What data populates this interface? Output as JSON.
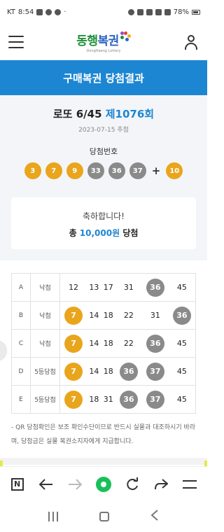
{
  "status_bar": {
    "carrier": "KT",
    "time": "8:54",
    "battery": "78%"
  },
  "app": {
    "logo_main": "동행",
    "logo_accent": "복권",
    "logo_sub": "DongHaeng Lottery"
  },
  "banner": {
    "title": "구매복권 당첨결과"
  },
  "draw": {
    "game": "로또 6/45",
    "round": "제1076회",
    "date": "2023-07-15 추첨",
    "numbers_label": "당첨번호",
    "numbers": [
      "3",
      "7",
      "9",
      "33",
      "36",
      "37"
    ],
    "plus": "+",
    "bonus": "10"
  },
  "prize": {
    "message": "축하합니다!",
    "prefix": "총",
    "amount": "10,000원",
    "suffix": "당첨"
  },
  "games": [
    {
      "label": "A",
      "result": "낙첨",
      "numbers": [
        "12",
        "13",
        "17",
        "31",
        "36",
        "45"
      ],
      "matched": [
        false,
        false,
        false,
        false,
        true,
        false
      ]
    },
    {
      "label": "B",
      "result": "낙첨",
      "numbers": [
        "7",
        "14",
        "18",
        "22",
        "31",
        "36"
      ],
      "matched": [
        true,
        false,
        false,
        false,
        false,
        true
      ]
    },
    {
      "label": "C",
      "result": "낙첨",
      "numbers": [
        "7",
        "14",
        "18",
        "22",
        "36",
        "45"
      ],
      "matched": [
        true,
        false,
        false,
        false,
        true,
        false
      ]
    },
    {
      "label": "D",
      "result": "5등당첨",
      "numbers": [
        "7",
        "14",
        "18",
        "36",
        "37",
        "45"
      ],
      "matched": [
        true,
        false,
        false,
        true,
        true,
        false
      ]
    },
    {
      "label": "E",
      "result": "5등당첨",
      "numbers": [
        "7",
        "18",
        "31",
        "36",
        "37",
        "45"
      ],
      "matched": [
        true,
        false,
        false,
        true,
        true,
        false
      ]
    }
  ],
  "notice": "- QR 당첨확인은 보조 확인수단이므로 반드시 실물과 대조하시기 바라며, 당첨금은 실물 복권소지자에게 지급합니다.",
  "colors": {
    "accent": "#1d86d2",
    "ball_low": "#e9a51c",
    "ball_high": "#8a8a8a",
    "logo_green": "#1f8f3a"
  },
  "browser_bar": [
    "n-icon",
    "back-arrow-icon",
    "forward-arrow-icon",
    "home-dot-icon",
    "refresh-icon",
    "share-icon",
    "menu-icon"
  ]
}
